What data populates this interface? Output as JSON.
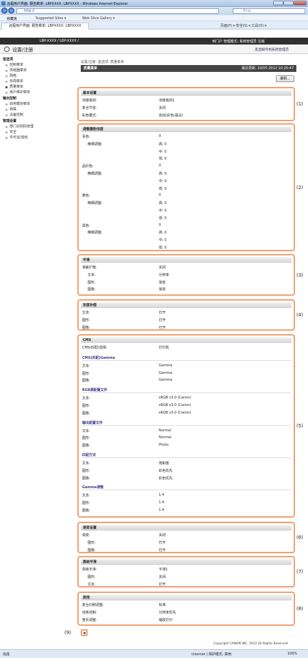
{
  "window": {
    "title": "远程用户界面: 报告菜单: LBPXXXX: LBPXXXX - Windows Internet Explorer"
  },
  "browser": {
    "url": "http://",
    "search_placeholder": "Bing",
    "fav_label": "收藏夹",
    "fav1": "Suggested Sites ▾",
    "fav2": "Web Slice Gallery ▾",
    "tab_title": "远程用户界面: 报告菜单: LBPXXXX: LBPXXXX",
    "cmds": "页面(P) ▾  安全(S) ▾  工具(O) ▾"
  },
  "header": {
    "model": "LBP-XXXX / LBP-XXXX /",
    "portal": "到门户  管理模式: 系统管理员  注销",
    "title": "设置/注册",
    "links": "发送邮件到系统管理员"
  },
  "sidebar": [
    {
      "label": "首选项",
      "g": 1
    },
    {
      "label": "控制菜单"
    },
    {
      "label": "供纸器菜单"
    },
    {
      "label": "网络"
    },
    {
      "label": "布局菜单"
    },
    {
      "label": "质量菜单",
      "sel": 1
    },
    {
      "label": "用户维护菜单"
    },
    {
      "label": "输出控制",
      "g": 1
    },
    {
      "label": "启用模块菜单"
    },
    {
      "label": "特殊"
    },
    {
      "label": "设备控制"
    },
    {
      "label": "管理设置",
      "g": 1
    },
    {
      "label": "部门识别码管理"
    },
    {
      "label": "安全"
    },
    {
      "label": "许可证/其他"
    }
  ],
  "main": {
    "breadcrumb": "设置/注册: 首选项: 质量菜单",
    "panel_title": "质量菜单",
    "updated": "最近更新: 10/05 2012 10:20:47",
    "edit_btn": "编辑..."
  },
  "sections": [
    {
      "n": "(1)",
      "title": "基本设置",
      "rows": [
        [
          "浓度级别:",
          "浓度级别1"
        ],
        [
          "复合节省:",
          "关闭"
        ],
        [
          "彩色模式:",
          "自动(彩色/黑白)"
        ]
      ]
    },
    {
      "n": "(2)",
      "title": "调整墨粉浓度",
      "rows": [
        [
          "青色:",
          "0"
        ],
        [
          "   精细调整:",
          "高: 0"
        ],
        [
          "",
          "中: 0"
        ],
        [
          "",
          "低: 0"
        ],
        [
          "品红色:",
          "0"
        ],
        [
          "   精细调整:",
          "高: 0"
        ],
        [
          "",
          "中: 0"
        ],
        [
          "",
          "低: 0"
        ],
        [
          "黄色:",
          "0"
        ],
        [
          "   精细调整:",
          "高: 0"
        ],
        [
          "",
          "中: 0"
        ],
        [
          "",
          "低: 0"
        ],
        [
          "黑色:",
          "0"
        ],
        [
          "   精细调整:",
          "高: 0"
        ],
        [
          "",
          "中: 0"
        ],
        [
          "",
          "低: 0"
        ]
      ]
    },
    {
      "n": "(3)",
      "title": "平滑",
      "rows": [
        [
          "误差扩散:",
          "关闭"
        ],
        [
          "   文本:",
          "分辨率"
        ],
        [
          "   图形:",
          "渐变"
        ],
        [
          "   图像:",
          "渐变"
        ]
      ]
    },
    {
      "n": "(4)",
      "title": "灰度补偿",
      "rows": [
        [
          "文本:",
          "打开"
        ],
        [
          "图形:",
          "打开"
        ],
        [
          "图像:",
          "打开"
        ]
      ]
    },
    {
      "n": "(5)",
      "title": "CMS",
      "rows": [
        [
          "CMS(匹配)选择:",
          "打印机"
        ]
      ],
      "subs": [
        {
          "t": "CMS(匹配)Gamma",
          "rows": [
            [
              "文本:",
              "Gamma"
            ],
            [
              "图形:",
              "Gamma"
            ],
            [
              "图像:",
              "Gamma"
            ]
          ]
        },
        {
          "t": "RGB源配置文件",
          "rows": [
            [
              "文本:",
              "sRGB v3.0 (Canon)"
            ],
            [
              "图形:",
              "sRGB v3.0 (Canon)"
            ],
            [
              "图像:",
              "sRGB v3.0 (Canon)"
            ]
          ]
        },
        {
          "t": "输出配置文件",
          "rows": [
            [
              "文本:",
              "Normal"
            ],
            [
              "图形:",
              "Normal"
            ],
            [
              "图像:",
              "Photo"
            ]
          ]
        },
        {
          "t": "匹配方法",
          "rows": [
            [
              "文本:",
              "饱和度"
            ],
            [
              "图形:",
              "彩色优先"
            ],
            [
              "图像:",
              "彩色优先"
            ]
          ]
        },
        {
          "t": "Gamma调整",
          "rows": [
            [
              "文本:",
              "1.4"
            ],
            [
              "图形:",
              "1.4"
            ],
            [
              "图像:",
              "1.4"
            ]
          ]
        }
      ]
    },
    {
      "n": "(6)",
      "title": "渐变设置",
      "rows": [
        [
          "渐变:",
          "关闭"
        ],
        [
          "   图形:",
          "打开"
        ],
        [
          "   图像:",
          "打开"
        ]
      ]
    },
    {
      "n": "(7)",
      "title": "高级平滑",
      "rows": [
        [
          "高级平滑:",
          "平滑1"
        ],
        [
          "   图形:",
          "关闭"
        ],
        [
          "   文本:",
          "打开"
        ]
      ]
    },
    {
      "n": "(8)",
      "title": "其他",
      "rows": [
        [
          "复合印刷调整:",
          "标准"
        ],
        [
          "线条控制:",
          "分辨率优先"
        ],
        [
          "宽长调整:",
          "缩放打印"
        ]
      ]
    }
  ],
  "callout9": "(9)",
  "footer": "Copyright CANON INC. 2012 All Rights Reserved",
  "status": {
    "left": "完成",
    "zone": "Internet | 保护模式: 禁用",
    "zoom": "100%"
  }
}
